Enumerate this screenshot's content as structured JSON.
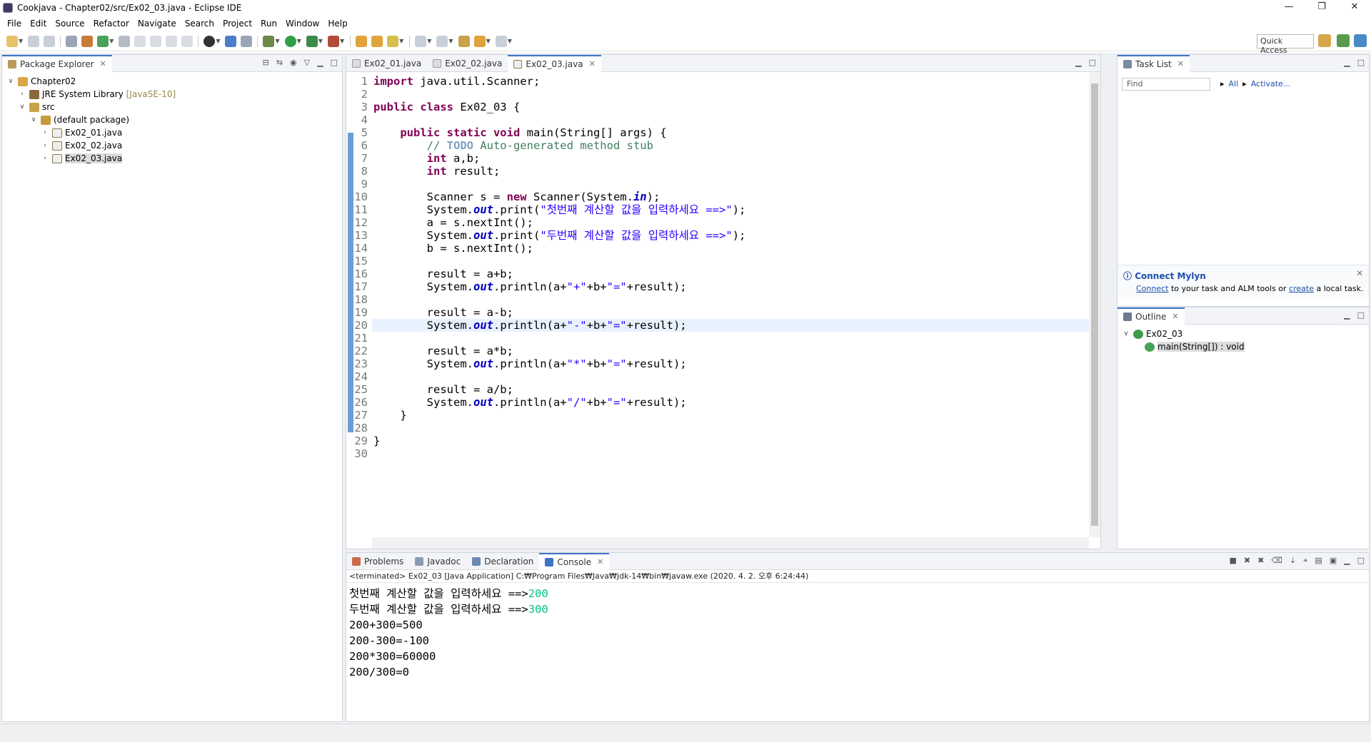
{
  "window": {
    "title": "Cookjava - Chapter02/src/Ex02_03.java - Eclipse IDE",
    "min": "—",
    "restore": "❐",
    "close": "✕"
  },
  "menu": [
    "File",
    "Edit",
    "Source",
    "Refactor",
    "Navigate",
    "Search",
    "Project",
    "Run",
    "Window",
    "Help"
  ],
  "toolbar": {
    "quick_access": "Quick Access"
  },
  "package_explorer": {
    "tab": "Package Explorer",
    "tree": [
      {
        "label": "Chapter02",
        "indent": 0,
        "twisty": "v"
      },
      {
        "label": "JRE System Library",
        "decor": "[JavaSE-10]",
        "indent": 1,
        "twisty": ">"
      },
      {
        "label": "src",
        "indent": 1,
        "twisty": "v"
      },
      {
        "label": "(default package)",
        "indent": 2,
        "twisty": "v"
      },
      {
        "label": "Ex02_01.java",
        "indent": 3,
        "twisty": ">"
      },
      {
        "label": "Ex02_02.java",
        "indent": 3,
        "twisty": ">"
      },
      {
        "label": "Ex02_03.java",
        "indent": 3,
        "twisty": ">",
        "selected": true
      }
    ]
  },
  "editor": {
    "tabs": [
      {
        "label": "Ex02_01.java",
        "active": false
      },
      {
        "label": "Ex02_02.java",
        "active": false
      },
      {
        "label": "Ex02_03.java",
        "active": true
      }
    ],
    "current_line": 20,
    "lines": [
      "1",
      "2",
      "3",
      "4",
      "5",
      "6",
      "7",
      "8",
      "9",
      "10",
      "11",
      "12",
      "13",
      "14",
      "15",
      "16",
      "17",
      "18",
      "19",
      "20",
      "21",
      "22",
      "23",
      "24",
      "25",
      "26",
      "27",
      "28",
      "29",
      "30"
    ],
    "code": {
      "l1_kw": "import",
      "l1": " java.util.Scanner;",
      "l3_kw": "public class",
      "l3": " Ex02_03 {",
      "l5_kw": "public static void",
      "l5": " main(String[] args) {",
      "l6_a": "// ",
      "l6_todo": "TODO",
      "l6_b": " Auto-generated method stub",
      "l7_kw": "int",
      "l7": " a,b;",
      "l8_kw": "int",
      "l8": " result;",
      "l10_a": "Scanner s = ",
      "l10_kw": "new",
      "l10_b": " Scanner(System.",
      "l10_f": "in",
      "l10_c": ");",
      "sys": "System.",
      "out": "out",
      "print": ".print(",
      "println": ".println(",
      "end": ");",
      "l11_str": "\"첫번째 계산할 값을 입력하세요 ==>\"",
      "l12": "a = s.nextInt();",
      "l13_str": "\"두번째 계산할 값을 입력하세요 ==>\"",
      "l14": "b = s.nextInt();",
      "l16": "result = a+b;",
      "l17_a": "a+",
      "l17_s1": "\"+\"",
      "l17_b": "+b+",
      "l17_s2": "\"=\"",
      "l17_c": "+result",
      "l19": "result = a-b;",
      "l20_s1": "\"-\"",
      "l22": "result = a*b;",
      "l23_s1": "\"*\"",
      "l25": "result = a/b;",
      "l26_s1": "\"/\"",
      "l27": "}",
      "l29": "}"
    }
  },
  "task_list": {
    "tab": "Task List",
    "find_placeholder": "Find",
    "all": "All",
    "activate": "Activate..."
  },
  "mylyn": {
    "title": "Connect Mylyn",
    "connect": "Connect",
    "mid": " to your task and ALM tools or ",
    "create": "create",
    "tail": " a local task."
  },
  "outline": {
    "tab": "Outline",
    "class": "Ex02_03",
    "method": "main(String[]) : void"
  },
  "bottom": {
    "tabs": [
      {
        "label": "Problems",
        "active": false
      },
      {
        "label": "Javadoc",
        "active": false
      },
      {
        "label": "Declaration",
        "active": false
      },
      {
        "label": "Console",
        "active": true
      }
    ],
    "info": "<terminated> Ex02_03 [Java Application] C:₩Program Files₩Java₩jdk-14₩bin₩javaw.exe (2020. 4. 2. 오후 6:24:44)",
    "out": [
      {
        "text": "첫번째 계산할 값을 입력하세요 ==>",
        "input": "200"
      },
      {
        "text": "두번째 계산할 값을 입력하세요 ==>",
        "input": "300"
      },
      {
        "text": "200+300=500",
        "input": ""
      },
      {
        "text": "200-300=-100",
        "input": ""
      },
      {
        "text": "200*300=60000",
        "input": ""
      },
      {
        "text": "200/300=0",
        "input": ""
      }
    ]
  },
  "colors": {
    "keyword": "#7f0055",
    "string": "#2a00ff",
    "comment": "#3f7f5f",
    "field": "#0000c0",
    "console_input": "#00c87d",
    "active_tab": "#3b74c6"
  }
}
